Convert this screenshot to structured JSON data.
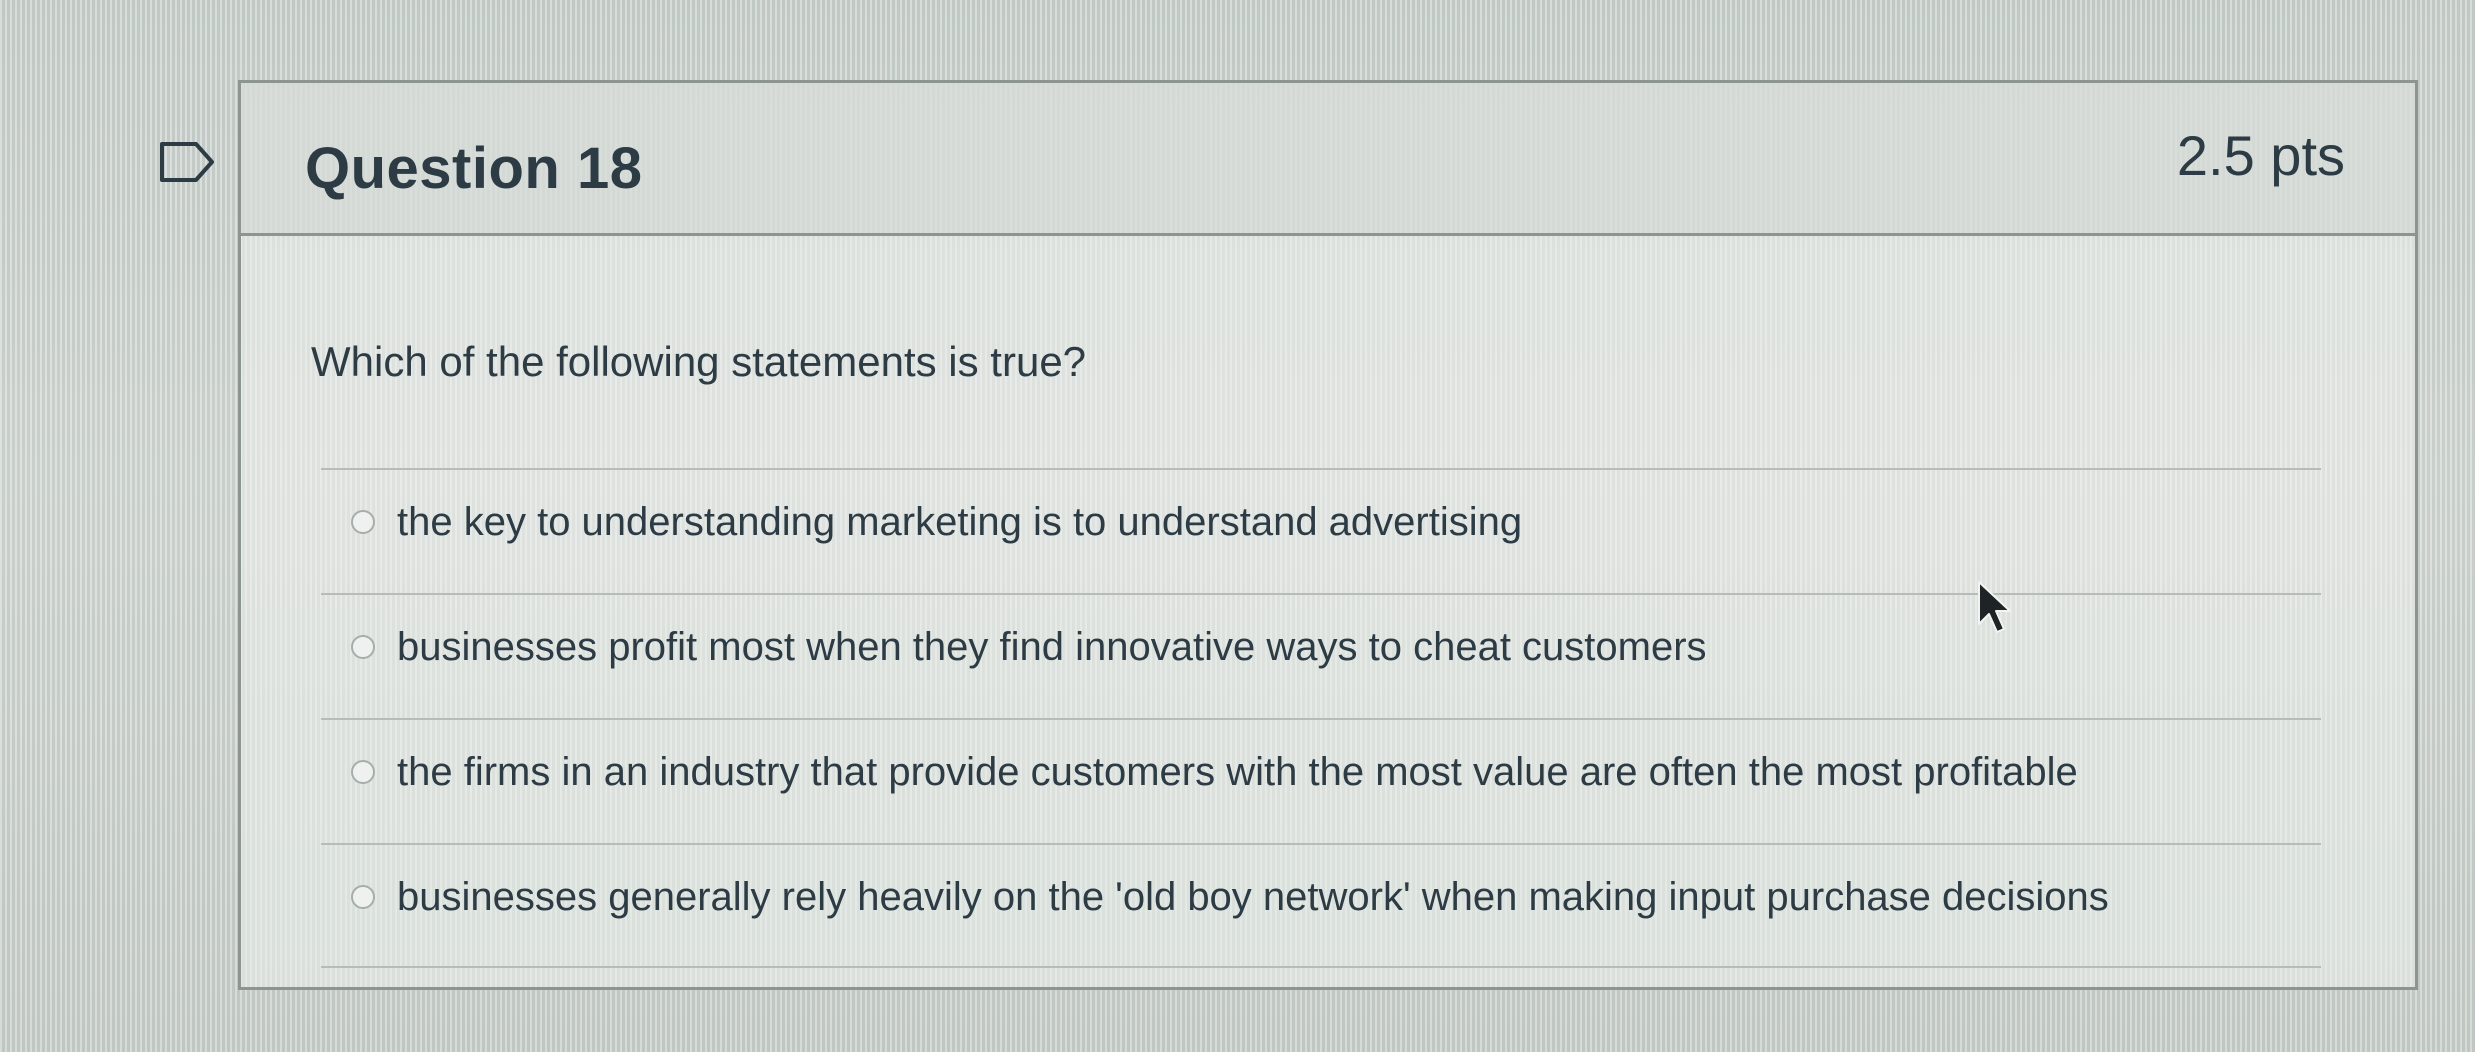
{
  "question": {
    "title": "Question 18",
    "points": "2.5 pts",
    "text": "Which of the following statements is true?",
    "answers": [
      {
        "label": "the key to understanding marketing is to understand advertising"
      },
      {
        "label": "businesses profit most when they find innovative ways to cheat customers"
      },
      {
        "label": "the firms in an industry that provide customers with the most value are often the most profitable"
      },
      {
        "label": "businesses generally rely heavily on the 'old boy network' when making input purchase decisions"
      }
    ]
  },
  "icons": {
    "flag": "flag-icon",
    "cursor": "mouse-pointer-icon",
    "radio": "radio-button"
  },
  "colors": {
    "text": "#2d3b45",
    "border": "#8c9590"
  }
}
